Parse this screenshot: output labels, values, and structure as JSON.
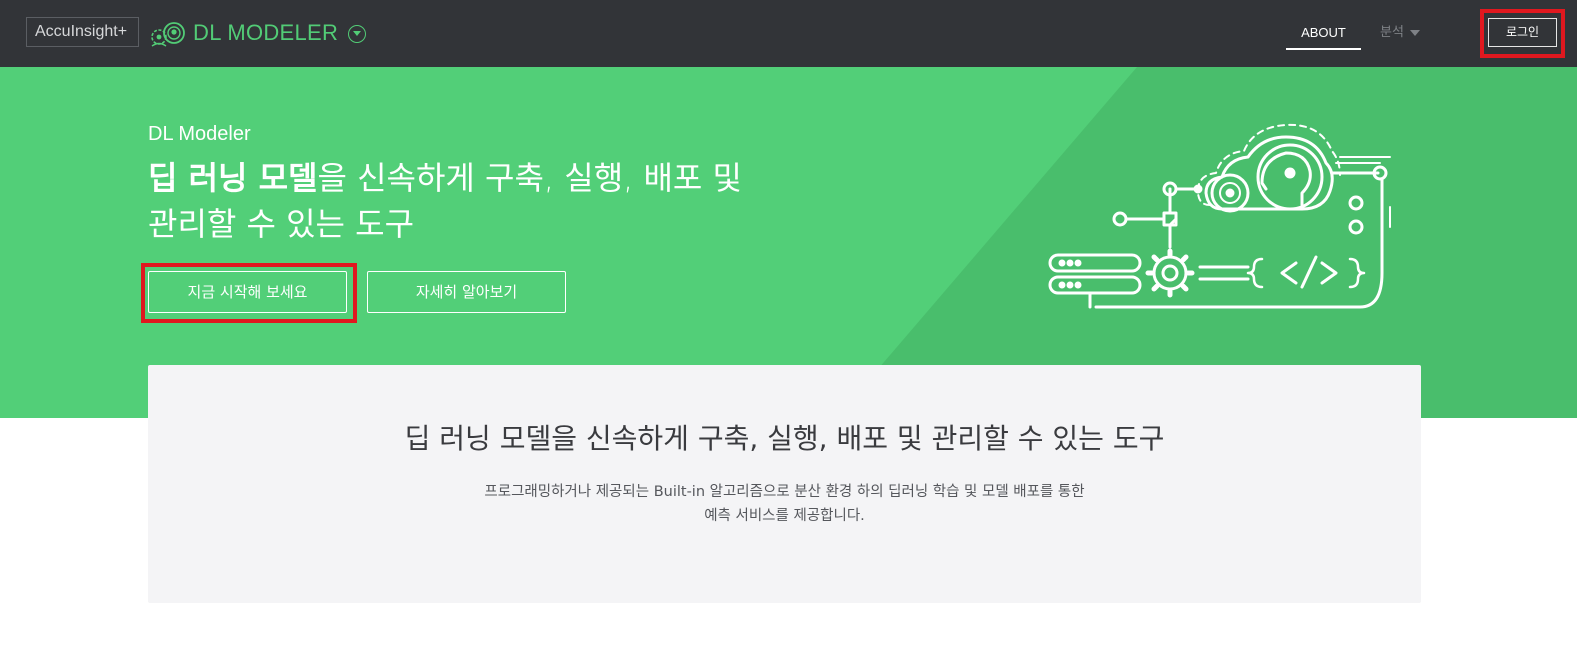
{
  "header": {
    "brand": "AccuInsight+",
    "product_name": "DL MODELER",
    "nav": {
      "about": "ABOUT",
      "analysis": "분석"
    },
    "login_label": "로그인"
  },
  "hero": {
    "kicker": "DL Modeler",
    "headline_bold": "딥 러닝 모델",
    "headline_rest": "을 신속하게 구축, 실행, 배포 및 관리할 수 있는 도구",
    "primary_button": "지금 시작해 보세요",
    "secondary_button": "자세히 알아보기"
  },
  "summary": {
    "title": "딥 러닝 모델을 신속하게 구축, 실행, 배포 및 관리할 수 있는 도구",
    "description_line1": "프로그래밍하거나 제공되는 Built-in 알고리즘으로 분산 환경 하의 딥러닝 학습 및 모델 배포를 통한",
    "description_line2": "예측 서비스를 제공합니다."
  },
  "colors": {
    "nav_bg": "#323438",
    "accent_green": "#52cf78",
    "highlight_red": "#e0181f",
    "card_bg": "#f4f4f6"
  },
  "icons": [
    "brain-gear-logo-icon",
    "chevron-down-icon",
    "caret-down-icon",
    "deep-learning-illustration-icon"
  ]
}
